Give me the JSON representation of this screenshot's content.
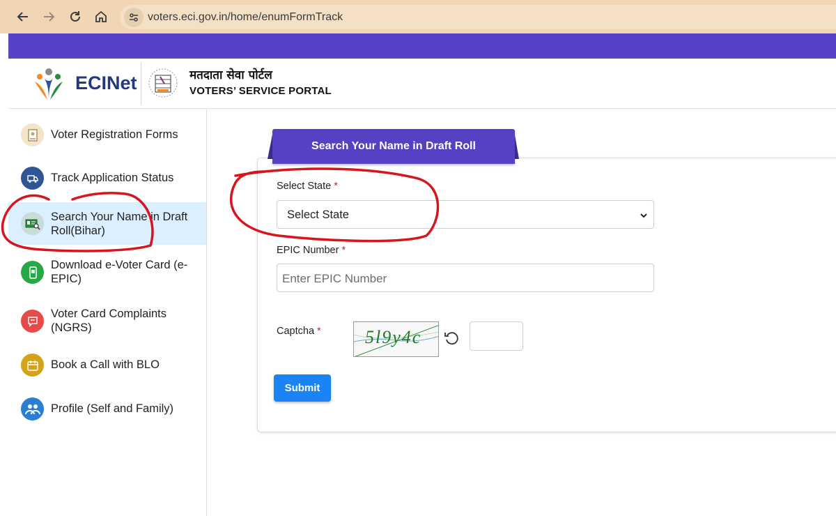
{
  "browser": {
    "url": "voters.eci.gov.in/home/enumFormTrack",
    "back_icon": "arrow-left-icon",
    "forward_icon": "arrow-right-icon",
    "reload_icon": "reload-icon",
    "home_icon": "home-icon"
  },
  "header": {
    "brand": "ECINet",
    "portal_hindi": "मतदाता सेवा पोर्टल",
    "portal_english": "VOTERS’ SERVICE PORTAL"
  },
  "sidebar": {
    "items": [
      {
        "label": "Voter Registration Forms",
        "icon": "form-icon",
        "color": "#f4e4c8"
      },
      {
        "label": "Track Application Status",
        "icon": "truck-icon",
        "color": "#2f5597"
      },
      {
        "label": "Search Your Name in Draft Roll(Bihar)",
        "icon": "id-search-icon",
        "color": "#c8dcd8",
        "active": true
      },
      {
        "label": "Download e-Voter Card (e-EPIC)",
        "icon": "phone-card-icon",
        "color": "#27a844"
      },
      {
        "label": "Voter Card Complaints (NGRS)",
        "icon": "complaint-icon",
        "color": "#e84a4a"
      },
      {
        "label": "Book a Call with BLO",
        "icon": "calendar-icon",
        "color": "#d4a317"
      },
      {
        "label": "Profile (Self and Family)",
        "icon": "family-icon",
        "color": "#2a7fd4"
      }
    ]
  },
  "form": {
    "title": "Search Your Name in Draft Roll",
    "state_label": "Select State",
    "state_value": "Select State",
    "epic_label": "EPIC Number",
    "epic_placeholder": "Enter EPIC Number",
    "captcha_label": "Captcha",
    "captcha_text": "5l9y4c",
    "captcha_value": "",
    "required_mark": "*",
    "submit_label": "Submit"
  },
  "colors": {
    "accent": "#5542c6",
    "primary_button": "#1a84f5",
    "annotation_red": "#d8141c"
  }
}
